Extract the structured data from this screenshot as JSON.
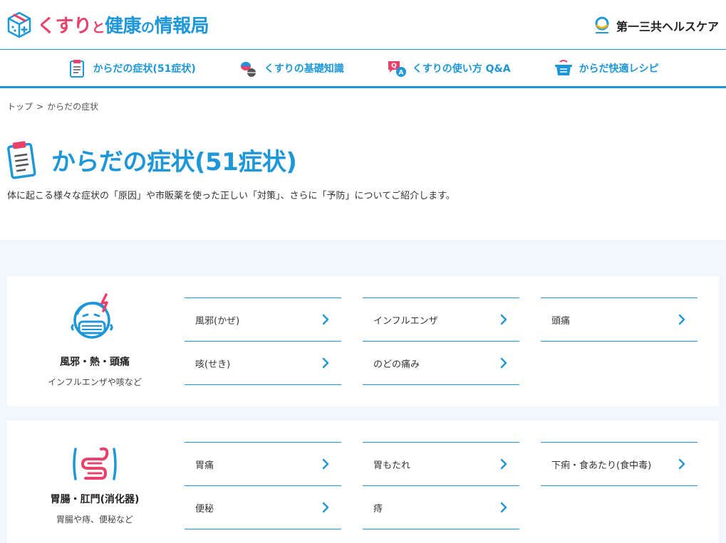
{
  "header": {
    "logo": {
      "part1": "くすり",
      "part2": "と",
      "part3": "健康",
      "part4": "の",
      "part5": "情報局"
    },
    "corp_name": "第一三共ヘルスケア"
  },
  "nav": {
    "items": [
      {
        "label": "からだの症状(51症状)",
        "icon": "clipboard-icon"
      },
      {
        "label": "くすりの基礎知識",
        "icon": "pills-icon"
      },
      {
        "label": "くすりの使い方 Q&A",
        "icon": "qa-bubble-icon"
      },
      {
        "label": "からだ快適レシピ",
        "icon": "cooking-pot-icon"
      }
    ]
  },
  "breadcrumb": {
    "home": "トップ",
    "separator": ">",
    "current": "からだの症状"
  },
  "page": {
    "title": "からだの症状(51症状)",
    "lead": "体に起こる様々な症状の「原因」や市販薬を使った正しい「対策」、さらに「予防」についてご紹介します。"
  },
  "categories": [
    {
      "name": "風邪・熱・頭痛",
      "sub": "インフルエンザや咳など",
      "icon": "cold-head-icon",
      "links": [
        "風邪(かぜ)",
        "インフルエンザ",
        "頭痛",
        "咳(せき)",
        "のどの痛み"
      ]
    },
    {
      "name": "胃腸・肛門(消化器)",
      "sub": "胃腸や痔、便秘など",
      "icon": "intestine-icon",
      "links": [
        "胃痛",
        "胃もたれ",
        "下痢・食あたり(食中毒)",
        "便秘",
        "痔"
      ]
    }
  ],
  "colors": {
    "brand_blue": "#1e97d8",
    "brand_pink": "#e8416a",
    "content_bg": "#f1f8fb"
  }
}
